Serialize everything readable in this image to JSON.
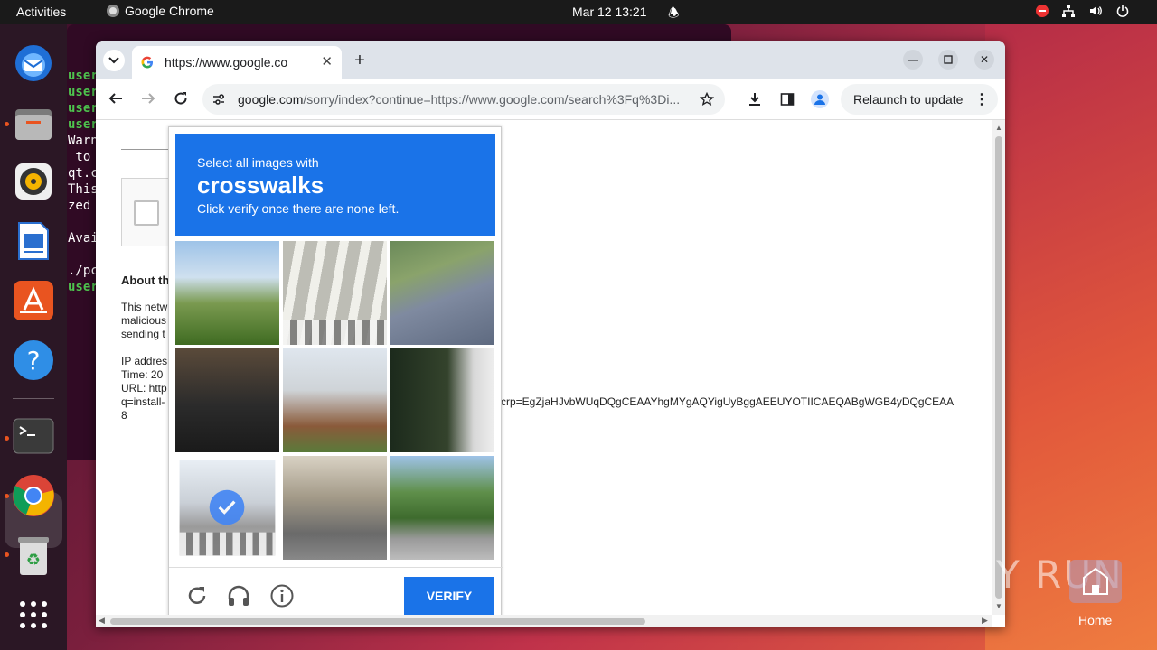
{
  "topbar": {
    "activities": "Activities",
    "app_name": "Google Chrome",
    "clock": "Mar 12  13:21"
  },
  "terminal": {
    "lines": [
      {
        "text": "user",
        "green": true
      },
      {
        "text": "user",
        "green": true
      },
      {
        "text": "user",
        "green": true
      },
      {
        "text": "user",
        "green": true
      },
      {
        "text": "Warn",
        "green": false
      },
      {
        "text": " to",
        "green": false
      },
      {
        "text": "qt.c",
        "green": false
      },
      {
        "text": "This",
        "green": false
      },
      {
        "text": "zed",
        "green": false
      },
      {
        "text": "",
        "green": false
      },
      {
        "text": "Avai",
        "green": false
      },
      {
        "text": "",
        "green": false
      },
      {
        "text": "./pc",
        "green": false
      },
      {
        "text": "user",
        "green": true
      }
    ]
  },
  "browser": {
    "tab_title": "https://www.google.co",
    "url_domain": "google.com",
    "url_path": "/sorry/index?continue=https://www.google.com/search%3Fq%3Di...",
    "relaunch_label": "Relaunch to update"
  },
  "page": {
    "about_heading": "About th",
    "body_lines": [
      "This netw",
      "malicious",
      "sending t"
    ],
    "info_lines": [
      "IP addres",
      "Time: 20",
      "URL: http",
      "q=install-",
      "8"
    ],
    "long_url_tail": "crp=EgZjaHJvbWUqDQgCEAAYhgMYgAQYigUyBggAEEUYOTIICAEQABgWGB4yDQgCEAA"
  },
  "captcha": {
    "instruction": "Select all images with",
    "target": "crosswalks",
    "subtext": "Click verify once there are none left.",
    "verify_label": "VERIFY",
    "tiles": [
      {
        "scene": "tree-grass",
        "selected": false
      },
      {
        "scene": "crosswalk-street",
        "selected": false
      },
      {
        "scene": "highway",
        "selected": false
      },
      {
        "scene": "motorcycle-dark",
        "selected": false
      },
      {
        "scene": "house-stairs",
        "selected": false
      },
      {
        "scene": "scooter-van",
        "selected": false
      },
      {
        "scene": "crosswalk-buildings",
        "selected": true
      },
      {
        "scene": "city-street-cyclist",
        "selected": false
      },
      {
        "scene": "tunnel-road",
        "selected": false
      }
    ]
  },
  "desktop": {
    "watermark": "ANY RUN",
    "home_label": "Home"
  },
  "colors": {
    "captcha_blue": "#1a73e8",
    "terminal_bg": "#300a24",
    "ubuntu_orange": "#e95420"
  }
}
